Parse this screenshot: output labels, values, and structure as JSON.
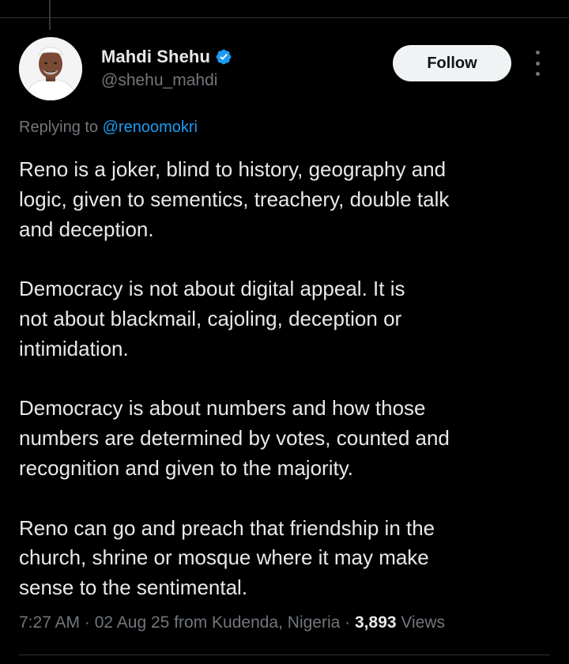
{
  "tweet": {
    "author": {
      "display_name": "Mahdi Shehu",
      "handle": "@shehu_mahdi",
      "verified": true,
      "verified_badge_icon": "verified-badge-icon",
      "verified_color": "#1d9bf0"
    },
    "follow_label": "Follow",
    "more_icon": "more-vertical-icon",
    "replying_to_prefix": "Replying to ",
    "replying_to_handle": "@renoomokri",
    "paragraphs": [
      "Reno is a joker, blind to history, geography and\nlogic, given to sementics, treachery, double talk\nand deception.",
      "Democracy is not about digital appeal. It is\nnot about blackmail, cajoling, deception or\nintimidation.",
      "Democracy is about numbers and how those\nnumbers are determined by votes, counted and\nrecognition and given to the majority.",
      "Reno can go and preach that friendship in the\nchurch, shrine or mosque where it  may make\nsense to the sentimental."
    ],
    "time": "7:27 AM",
    "date": "02 Aug 25",
    "location": "from Kudenda, Nigeria",
    "views_count": "3,893",
    "views_label": "Views",
    "separator": "·"
  },
  "colors": {
    "background": "#000000",
    "text_primary": "#e7e9ea",
    "text_secondary": "#71767b",
    "link": "#1d9bf0",
    "divider": "#2f3336"
  }
}
